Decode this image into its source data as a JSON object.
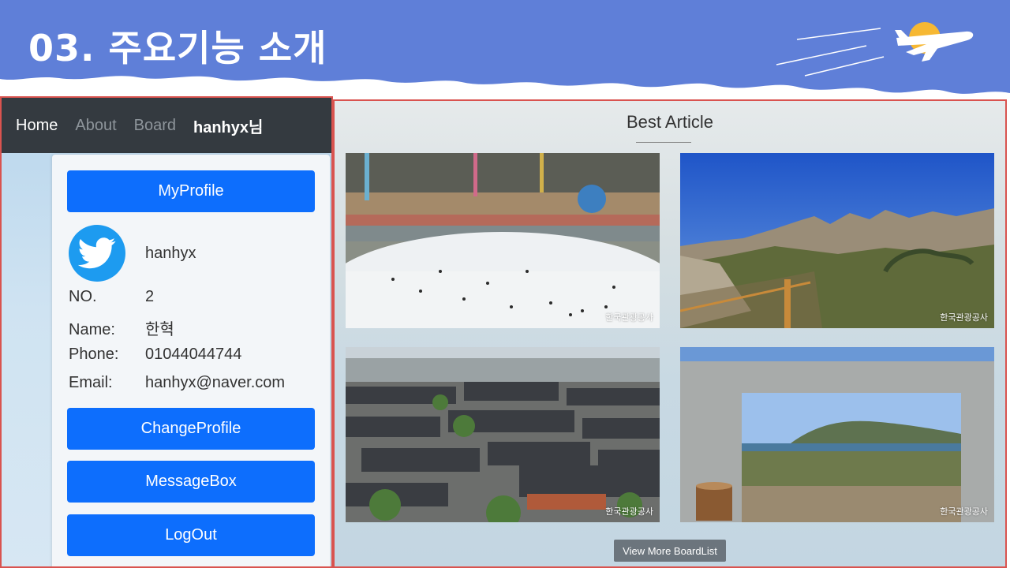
{
  "slide": {
    "title": "03. 주요기능 소개"
  },
  "colors": {
    "header_blue": "#5f7fd8",
    "primary_button": "#0d6efd",
    "navbar": "#343a40",
    "panel_border": "#d9534f"
  },
  "navbar": {
    "links": [
      "Home",
      "About",
      "Board"
    ],
    "user": "hanhyx님"
  },
  "profile": {
    "myprofile_button": "MyProfile",
    "username": "hanhyx",
    "avatar_icon": "twitter-bird-icon",
    "fields": [
      {
        "label": "NO.",
        "value": "2"
      },
      {
        "label": "Name:",
        "value": "한혁"
      },
      {
        "label": "Phone:",
        "value": "01044044744"
      },
      {
        "label": "Email:",
        "value": "hanhyx@naver.com"
      }
    ],
    "change_button": "ChangeProfile",
    "message_button": "MessageBox",
    "logout_button": "LogOut"
  },
  "best": {
    "title": "Best Article",
    "articles": [
      {
        "image": "indoor-ice-rink-photo",
        "watermark": "한국관광공사"
      },
      {
        "image": "rocky-mountain-photo",
        "watermark": "한국관광공사"
      },
      {
        "image": "hanok-village-photo",
        "watermark": "한국관광공사"
      },
      {
        "image": "seaside-frame-photo",
        "watermark": "한국관광공사"
      }
    ],
    "more_button": "View More BoardList"
  }
}
